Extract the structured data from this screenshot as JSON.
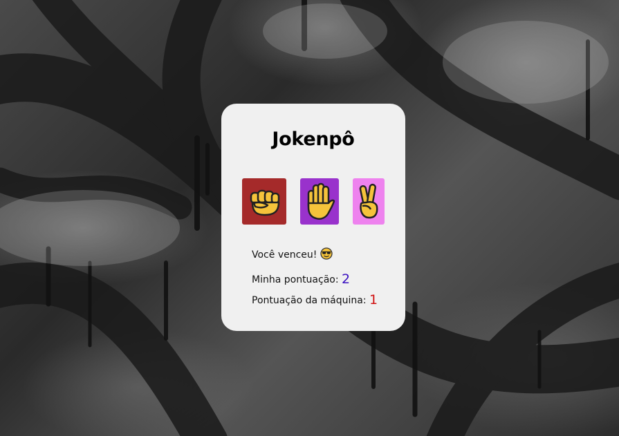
{
  "game": {
    "title": "Jokenpô",
    "choices": [
      {
        "id": "rock",
        "icon": "fist-icon",
        "color": "#a52a2a"
      },
      {
        "id": "paper",
        "icon": "raised-hand-icon",
        "color": "#9932cc"
      },
      {
        "id": "scissors",
        "icon": "victory-hand-icon",
        "color": "#ee82ee"
      }
    ],
    "result": {
      "text": "Você venceu!",
      "icon": "sunglasses-face-icon"
    },
    "scores": {
      "player_label": "Minha pontuação:",
      "player_value": "2",
      "player_color": "#3a10c0",
      "machine_label": "Pontuação da máquina:",
      "machine_value": "1",
      "machine_color": "#d01010"
    }
  }
}
